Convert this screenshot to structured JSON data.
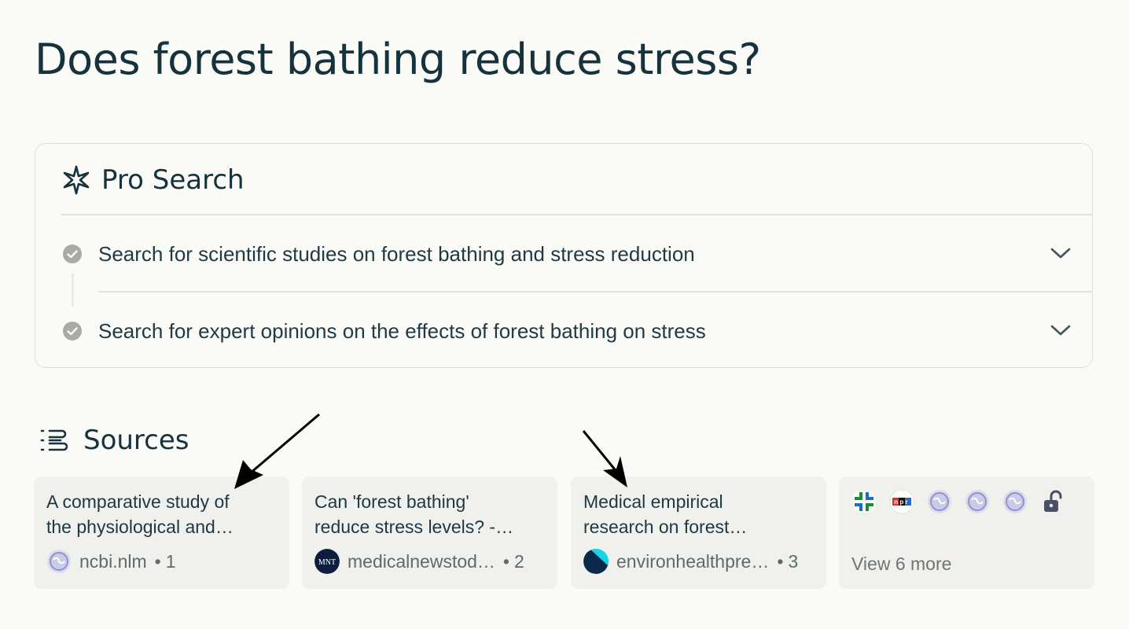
{
  "query": {
    "title": "Does forest bathing reduce stress?"
  },
  "pro_search": {
    "title": "Pro Search",
    "steps": [
      {
        "label": "Search for scientific studies on forest bathing and stress reduction",
        "status": "completed"
      },
      {
        "label": "Search for expert opinions on the effects of forest bathing on stress",
        "status": "completed"
      }
    ]
  },
  "sources": {
    "title": "Sources",
    "items": [
      {
        "title_line1": "A comparative study of",
        "title_line2": "the physiological and…",
        "domain": "ncbi.nlm",
        "index": "1",
        "favicon": "globe-icon"
      },
      {
        "title_line1": "Can 'forest bathing'",
        "title_line2": "reduce stress levels? -…",
        "domain": "medicalnewstod…",
        "index": "2",
        "favicon": "mnt-logo-icon"
      },
      {
        "title_line1": "Medical empirical",
        "title_line2": "research on forest…",
        "domain": "environhealthpre…",
        "index": "3",
        "favicon": "ehp-logo-icon"
      }
    ],
    "more": {
      "label": "View 6 more",
      "icons": [
        "cleveland-clinic-icon",
        "npr-icon",
        "globe-icon",
        "globe-icon",
        "globe-icon",
        "unlock-icon"
      ]
    }
  },
  "colors": {
    "background": "#fafaf6",
    "text": "#16323c",
    "card": "#f0f0ec",
    "check": "#a9a9a6",
    "muted": "#5d6a6e"
  },
  "favicon_text": {
    "mnt": "MNT",
    "npr": "npr"
  },
  "separator": "•"
}
